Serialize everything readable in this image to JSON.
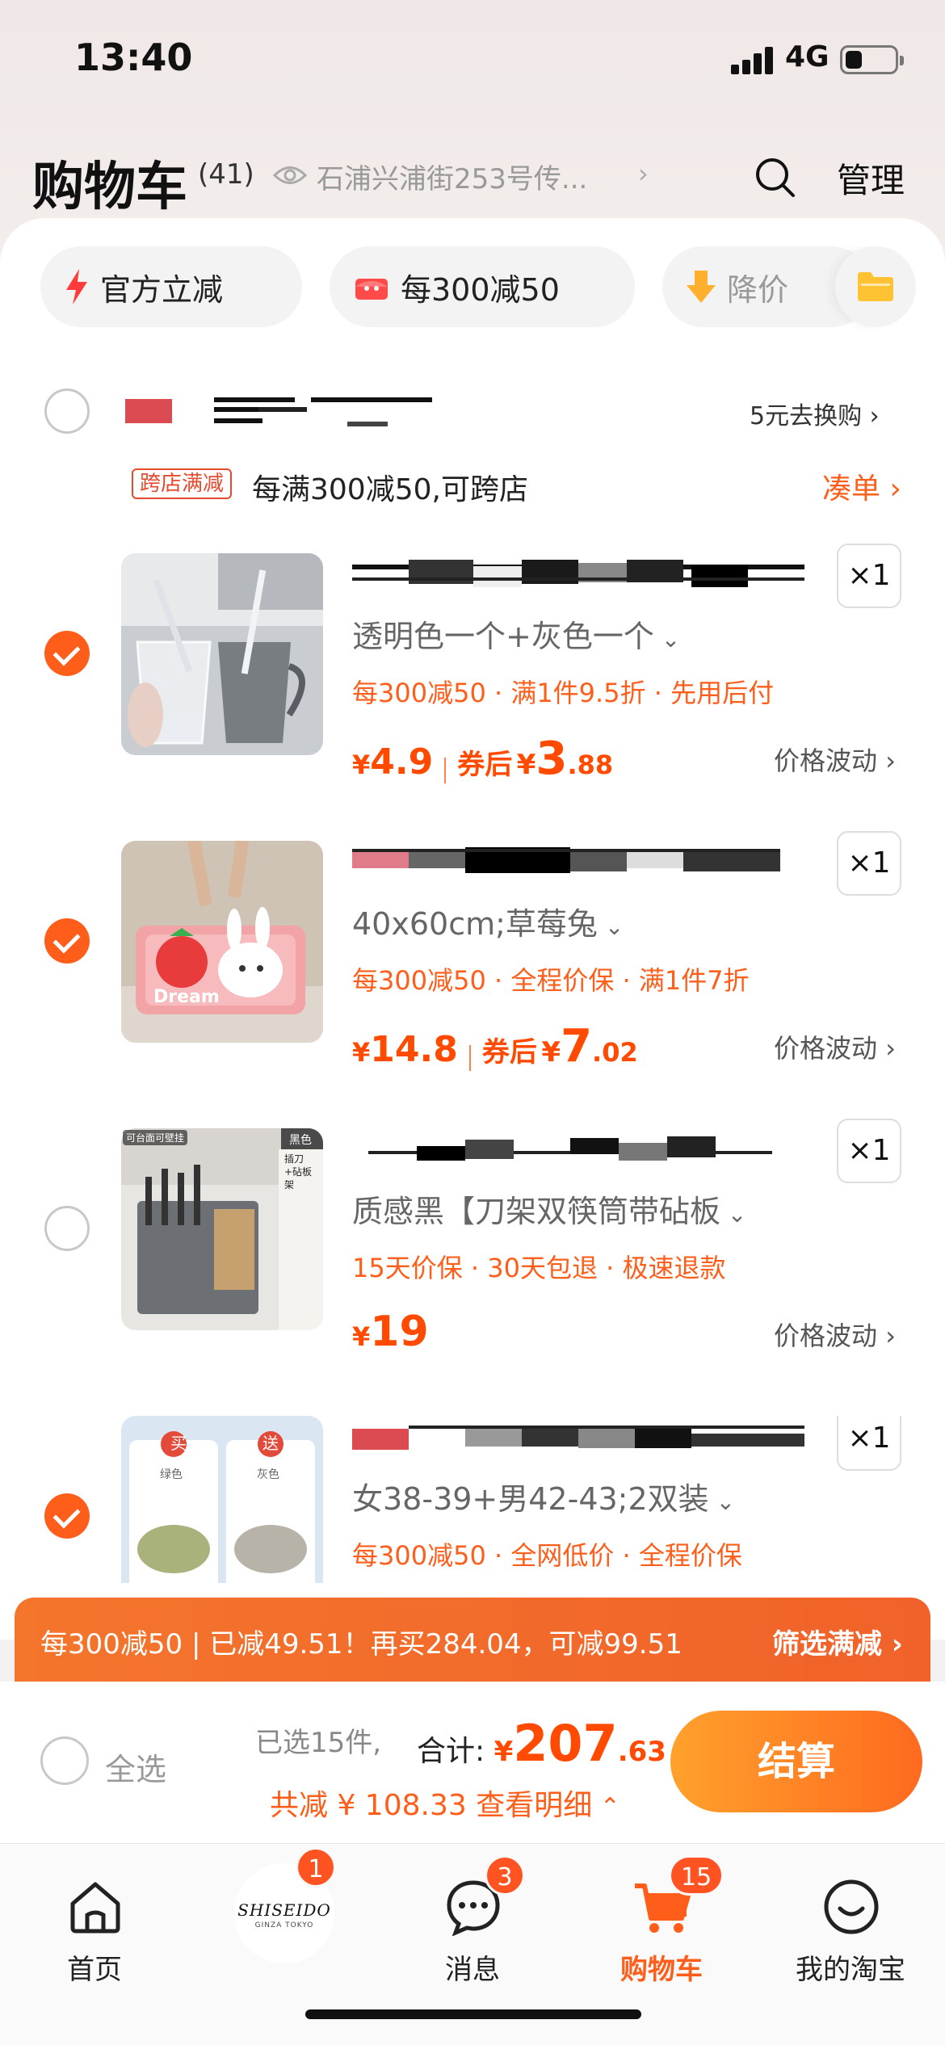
{
  "status_bar": {
    "time": "13:40",
    "network": "4G",
    "battery_level": 0.35
  },
  "header": {
    "title": "购物车",
    "count": "(41)",
    "address": "石浦兴浦街253号传...",
    "address_icon": "eye-icon",
    "search_icon": "search-icon",
    "manage_label": "管理"
  },
  "filter_chips": [
    {
      "icon": "lightning-icon",
      "label": "官方立减"
    },
    {
      "icon": "discount-icon",
      "label": "每300减50"
    },
    {
      "icon": "price-drop-icon",
      "label": "降价"
    }
  ],
  "shop": {
    "right_label": "5元去换购",
    "promo_tag": "跨店满减",
    "promo_text": "每满300减50,可跨店",
    "coudan_label": "凑单"
  },
  "items": [
    {
      "checked": true,
      "qty": "×1",
      "spec": "透明色一个+灰色一个",
      "benefits": "每300减50 · 满1件9.5折 · 先用后付",
      "price_currency": "¥",
      "price": "4.9",
      "after_label": "券后",
      "after_currency": "¥",
      "after_int": "3",
      "after_dec": ".88",
      "fluct": "价格波动"
    },
    {
      "checked": true,
      "qty": "×1",
      "spec": "40x60cm;草莓兔",
      "benefits": "每300减50 · 全程价保 · 满1件7折",
      "price_currency": "¥",
      "price": "14.8",
      "after_label": "券后",
      "after_currency": "¥",
      "after_int": "7",
      "after_dec": ".02",
      "fluct": "价格波动"
    },
    {
      "checked": false,
      "qty": "×1",
      "spec": "质感黑【刀架双筷筒带砧板",
      "benefits": "15天价保 · 30天包退 · 极速退款",
      "price_currency": "¥",
      "price": "19",
      "fluct": "价格波动",
      "thumb_tags": [
        "可台面可壁挂",
        "黑色",
        "插刀+砧板架"
      ]
    },
    {
      "checked": true,
      "qty": "×1",
      "spec": "女38-39+男42-43;2双装",
      "benefits": "每300减50 · 全网低价 · 全程价保",
      "thumb_tags": [
        "买",
        "送",
        "绿色",
        "灰色"
      ]
    }
  ],
  "promo_bar": {
    "left": "每300减50 | 已减49.51！再买284.04，可减99.51",
    "right": "筛选满减"
  },
  "checkout": {
    "select_all": "全选",
    "selected": "已选15件,",
    "total_label": "合计:",
    "total_currency": "¥",
    "total_int": "207",
    "total_dec": ".63",
    "saved": "共减 ¥ 108.33  查看明细",
    "pay_label": "结算"
  },
  "tabbar": [
    {
      "label": "首页",
      "icon": "home-icon"
    },
    {
      "label": "",
      "icon": "shiseido-logo",
      "badge": "1",
      "logo_text": "SHISEIDO",
      "logo_sub": "GINZA TOKYO"
    },
    {
      "label": "消息",
      "icon": "message-icon",
      "badge": "3"
    },
    {
      "label": "购物车",
      "icon": "cart-icon",
      "badge": "15"
    },
    {
      "label": "我的淘宝",
      "icon": "smile-icon"
    }
  ],
  "colors": {
    "accent": "#ff5e1a",
    "price": "#ff4a00",
    "promo_bar": "#f0622a"
  }
}
